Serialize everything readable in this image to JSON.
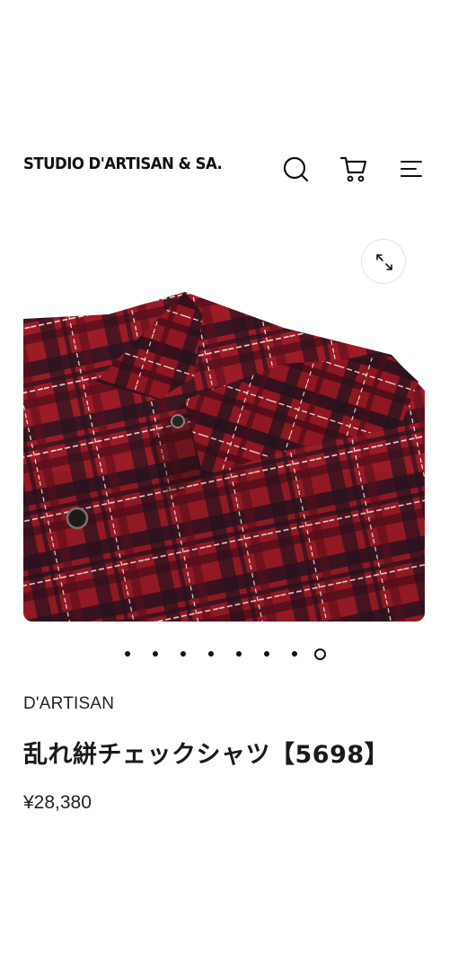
{
  "header": {
    "logo_text": "STUDIO D'ARTISAN & SA.",
    "icons": {
      "search": "search-icon",
      "cart": "cart-icon",
      "menu": "menu-icon"
    }
  },
  "gallery": {
    "expand_icon": "expand-icon",
    "image_alt": "Red and black plaid shirt",
    "dots": [
      {
        "active": false
      },
      {
        "active": false
      },
      {
        "active": false
      },
      {
        "active": false
      },
      {
        "active": false
      },
      {
        "active": false
      },
      {
        "active": false
      },
      {
        "active": true
      }
    ]
  },
  "product": {
    "brand": "D'ARTISAN",
    "title": "乱れ絣チェックシャツ【5698】",
    "price": "¥28,380"
  },
  "colors": {
    "text": "#1a1a1a",
    "fabric_red": "#9b1b26",
    "fabric_dark": "#1f1420"
  }
}
